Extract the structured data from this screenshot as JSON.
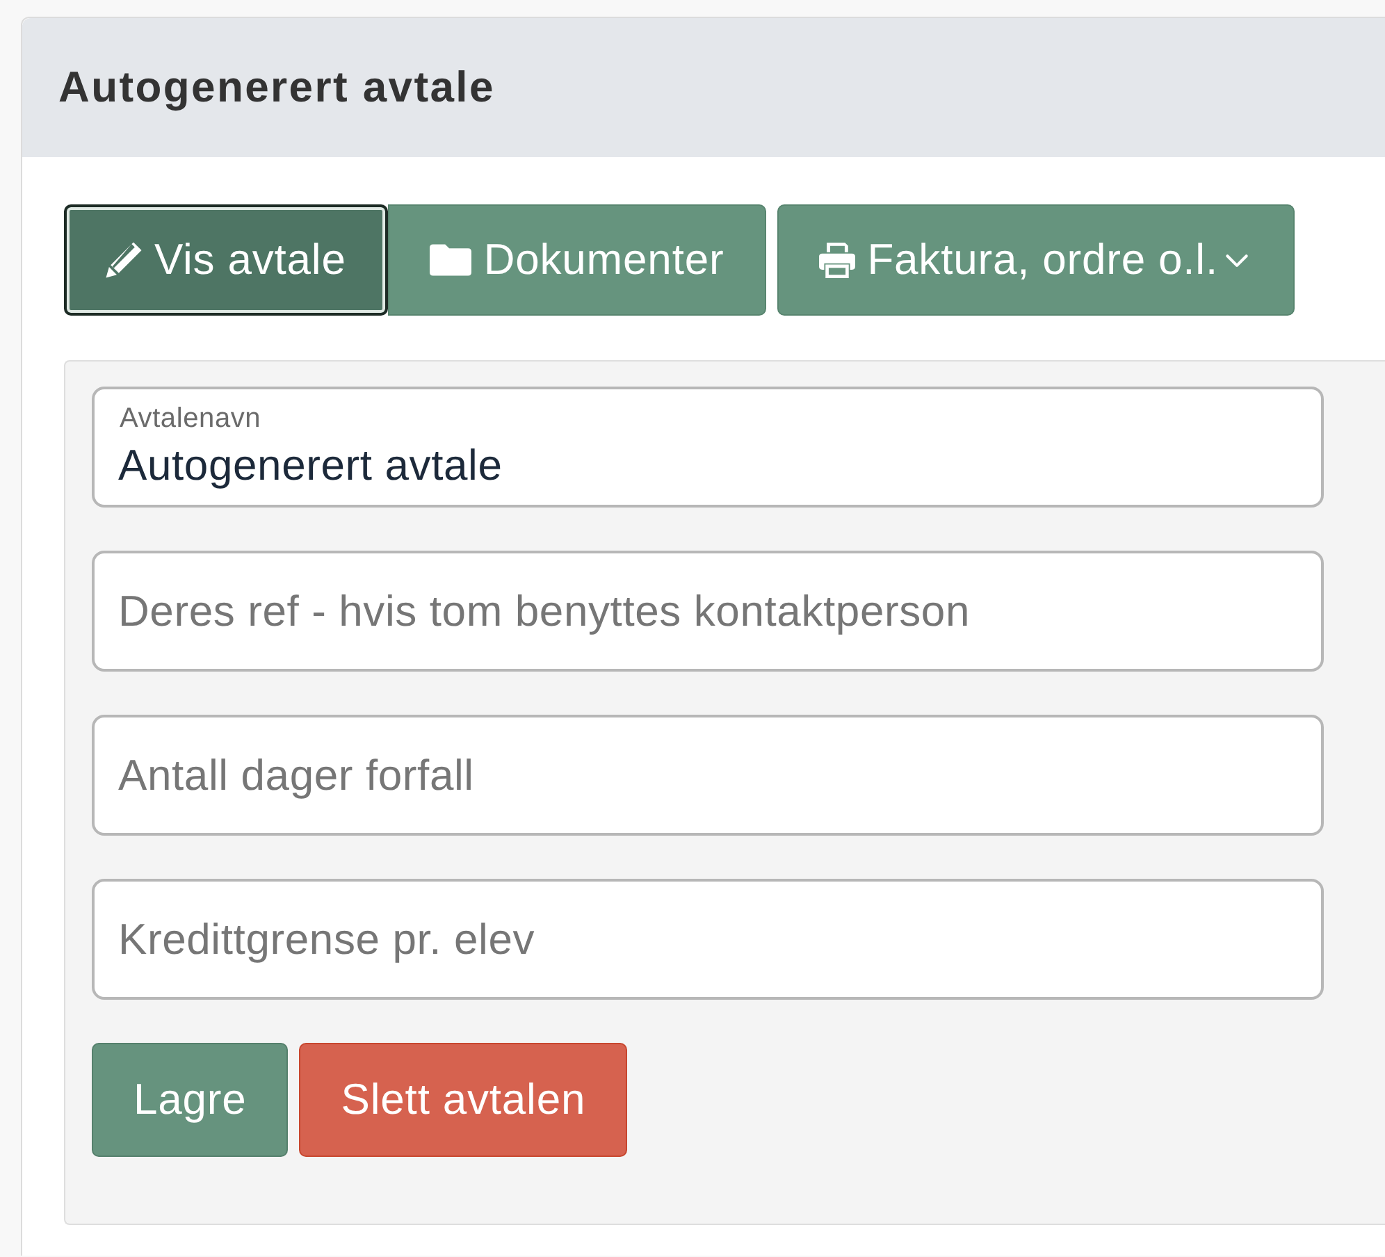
{
  "header": {
    "title": "Autogenerert avtale"
  },
  "tabs": [
    {
      "label": "Vis avtale",
      "selected": true
    },
    {
      "label": "Dokumenter",
      "selected": false
    }
  ],
  "menu_button": {
    "label": "Faktura, ordre o.l."
  },
  "fields": [
    {
      "label": "Avtalenavn",
      "value": "Autogenerert avtale"
    },
    {
      "placeholder": "Deres ref - hvis tom benyttes kontaktperson"
    },
    {
      "placeholder": "Antall dager forfall"
    },
    {
      "placeholder": "Kredittgrense pr. elev"
    }
  ],
  "buttons": [
    {
      "label": "Lagre",
      "kind": "primary"
    },
    {
      "label": "Slett avtalen",
      "kind": "danger"
    }
  ]
}
